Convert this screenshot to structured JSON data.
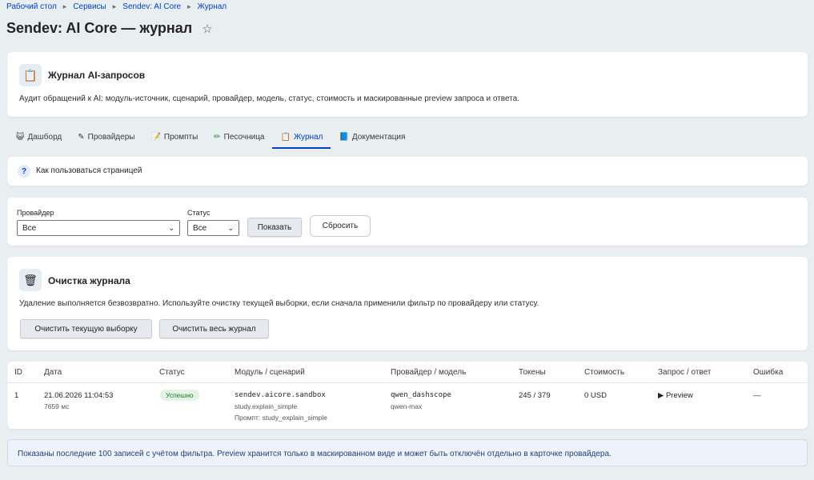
{
  "breadcrumb": [
    "Рабочий стол",
    "Сервисы",
    "Sendev: AI Core",
    "Журнал"
  ],
  "page_title": "Sendev: AI Core — журнал",
  "header": {
    "title": "Журнал AI-запросов",
    "description": "Аудит обращений к AI: модуль-источник, сценарий, провайдер, модель, статус, стоимость и маскированные preview запроса и ответа."
  },
  "tabs": [
    {
      "icon": "😺",
      "label": "Дашборд"
    },
    {
      "icon": "✎",
      "label": "Провайдеры"
    },
    {
      "icon": "📝",
      "label": "Промпты"
    },
    {
      "icon": "✏",
      "label": "Песочница"
    },
    {
      "icon": "📋",
      "label": "Журнал"
    },
    {
      "icon": "📘",
      "label": "Документация"
    }
  ],
  "help": {
    "icon": "?",
    "label": "Как пользоваться страницей"
  },
  "filter": {
    "provider_label": "Провайдер",
    "provider_value": "Все",
    "status_label": "Статус",
    "status_value": "Все",
    "show_button": "Показать",
    "reset_button": "Сбросить"
  },
  "clean": {
    "title": "Очистка журнала",
    "description": "Удаление выполняется безвозвратно. Используйте очистку текущей выборки, если сначала применили фильтр по провайдеру или статусу.",
    "clear_selection_button": "Очистить текущую выборку",
    "clear_all_button": "Очистить весь журнал"
  },
  "table": {
    "columns": [
      "ID",
      "Дата",
      "Статус",
      "Модуль / сценарий",
      "Провайдер / модель",
      "Токены",
      "Стоимость",
      "Запрос / ответ",
      "Ошибка"
    ],
    "rows": [
      {
        "id": "1",
        "date": "21.06.2026 11:04:53",
        "duration": "7659 мс",
        "status": "Успешно",
        "module": "sendev.aicore.sandbox",
        "scenario": "study.explain_simple",
        "prompt": "Промпт: study_explain_simple",
        "provider": "qwen_dashscope",
        "model": "qwen-max",
        "tokens": "245 / 379",
        "cost": "0 USD",
        "preview": "▶ Preview",
        "error": "—"
      }
    ]
  },
  "notice": "Показаны последние 100 записей с учётом фильтра. Preview хранится только в маскированном виде и может быть отключён отдельно в карточке провайдера.",
  "colors": {
    "accent": "#003ecc",
    "success_bg": "#e4f3e4",
    "success_text": "#1f7a2e",
    "page_bg": "#e9eef0"
  }
}
